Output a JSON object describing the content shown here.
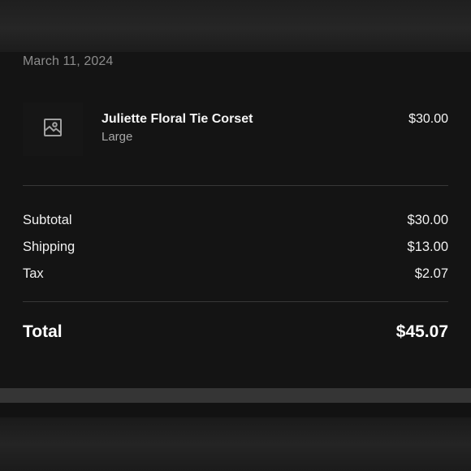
{
  "order": {
    "date": "March 11, 2024"
  },
  "item": {
    "icon": "image-placeholder-icon",
    "name": "Juliette Floral Tie Corset",
    "variant": "Large",
    "price": "$30.00"
  },
  "summary": {
    "subtotal_label": "Subtotal",
    "subtotal_value": "$30.00",
    "shipping_label": "Shipping",
    "shipping_value": "$13.00",
    "tax_label": "Tax",
    "tax_value": "$2.07",
    "total_label": "Total",
    "total_value": "$45.07"
  },
  "colors": {
    "background": "#141414",
    "text_primary": "#f2f2f2",
    "text_secondary": "#8c8c8c",
    "divider": "#383838"
  }
}
